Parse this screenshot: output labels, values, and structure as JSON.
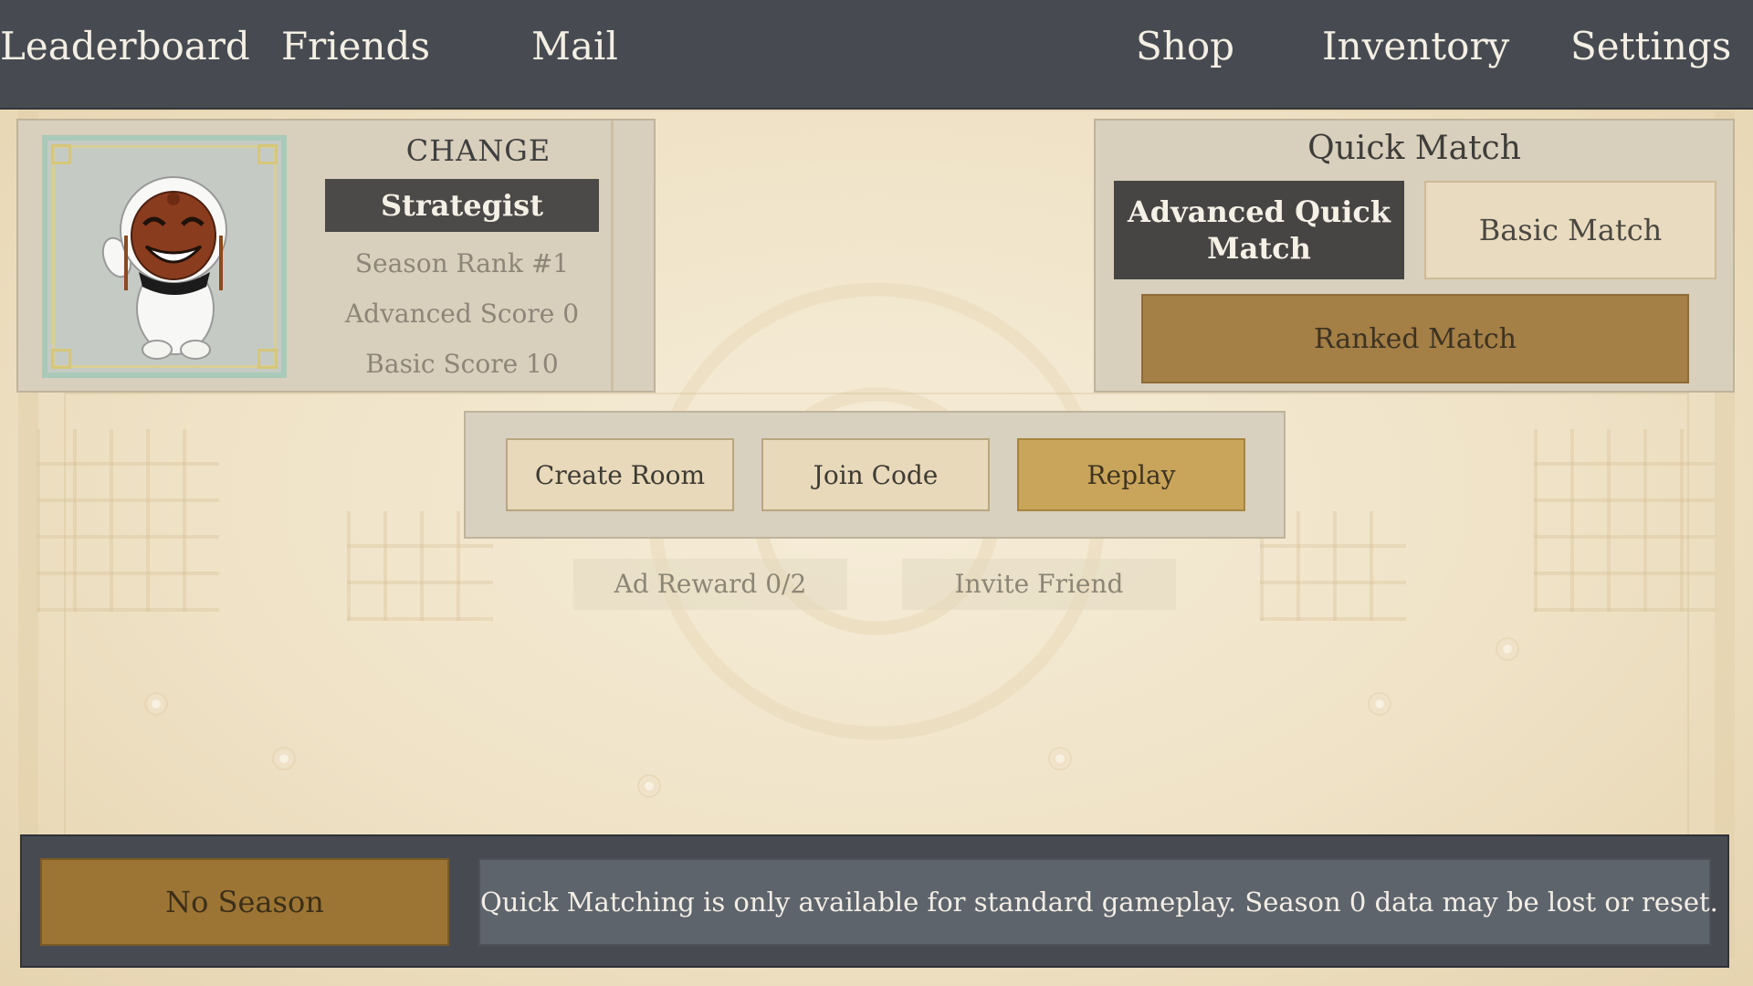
{
  "nav": {
    "leaderboard": "Leaderboard",
    "friends": "Friends",
    "mail": "Mail",
    "shop": "Shop",
    "inventory": "Inventory",
    "settings": "Settings"
  },
  "profile": {
    "change_label": "CHANGE",
    "title": "Strategist",
    "season_rank": "Season Rank #1",
    "advanced_score": "Advanced Score 0",
    "basic_score": "Basic Score 10",
    "avatar_icon": "masked-character-avatar"
  },
  "quick_match": {
    "title": "Quick Match",
    "advanced_quick_match": "Advanced Quick Match",
    "basic_match": "Basic Match",
    "ranked_match": "Ranked Match"
  },
  "room": {
    "create_room": "Create Room",
    "join_code": "Join Code",
    "replay": "Replay"
  },
  "extras": {
    "ad_reward": "Ad Reward 0/2",
    "invite_friend": "Invite Friend"
  },
  "bottom": {
    "season": "No Season",
    "notice": "Quick Matching is only available for standard gameplay. Season 0 data may be lost or reset."
  },
  "colors": {
    "nav_bg": "#474b51",
    "panel_bg": "#d8cfbd",
    "dark_button": "#464543",
    "brown_button": "#a47f46",
    "gold_button": "#c9a55b"
  }
}
